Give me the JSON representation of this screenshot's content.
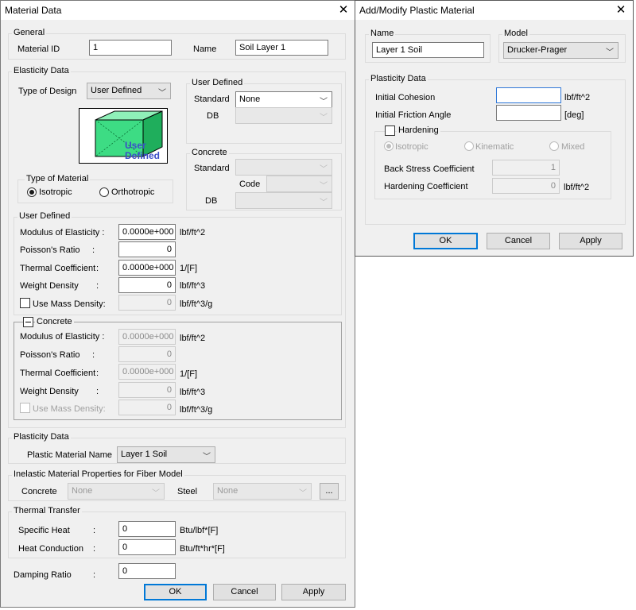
{
  "material_window": {
    "title": "Material Data",
    "general": {
      "group": "General",
      "id_label": "Material ID",
      "id_value": "1",
      "name_label": "Name",
      "name_value": "Soil Layer 1"
    },
    "elasticity": {
      "group": "Elasticity Data",
      "type_of_design_label": "Type of Design",
      "type_of_design_value": "User Defined",
      "image_text_line1": "User",
      "image_text_line2": "Defined",
      "type_of_material_group": "Type of Material",
      "isotropic": "Isotropic",
      "orthotropic": "Orthotropic",
      "user_defined_group": "User Defined",
      "standard_label": "Standard",
      "standard_value": "None",
      "db_label": "DB",
      "db_value": "",
      "concrete_group": "Concrete",
      "concrete_standard_label": "Standard",
      "concrete_standard_value": "",
      "code_label": "Code",
      "code_value": "",
      "concrete_db_label": "DB",
      "concrete_db_value": ""
    },
    "user_defined": {
      "group": "User Defined",
      "modulus_label": "Modulus of Elasticity :",
      "modulus_value": "0.0000e+000",
      "modulus_unit": "lbf/ft^2",
      "poisson_label": "Poisson's Ratio",
      "poisson_colon": ":",
      "poisson_value": "0",
      "thermal_label": "Thermal Coefficient",
      "thermal_colon": ":",
      "thermal_value": "0.0000e+000",
      "thermal_unit": "1/[F]",
      "weight_label": "Weight Density",
      "weight_colon": ":",
      "weight_value": "0",
      "weight_unit": "lbf/ft^3",
      "mass_label": "Use Mass Density:",
      "mass_value": "0",
      "mass_unit": "lbf/ft^3/g"
    },
    "concrete": {
      "group": "Concrete",
      "modulus_label": "Modulus of Elasticity :",
      "modulus_value": "0.0000e+000",
      "modulus_unit": "lbf/ft^2",
      "poisson_label": "Poisson's Ratio",
      "poisson_colon": ":",
      "poisson_value": "0",
      "thermal_label": "Thermal Coefficient",
      "thermal_colon": ":",
      "thermal_value": "0.0000e+000",
      "thermal_unit": "1/[F]",
      "weight_label": "Weight Density",
      "weight_colon": ":",
      "weight_value": "0",
      "weight_unit": "lbf/ft^3",
      "mass_label": "Use Mass Density:",
      "mass_value": "0",
      "mass_unit": "lbf/ft^3/g"
    },
    "plasticity": {
      "group": "Plasticity Data",
      "name_label": "Plastic Material Name",
      "name_value": "Layer 1 Soil"
    },
    "inelastic": {
      "group": "Inelastic Material Properties for Fiber Model",
      "concrete_label": "Concrete",
      "concrete_value": "None",
      "steel_label": "Steel",
      "steel_value": "None",
      "more_label": "..."
    },
    "thermal": {
      "group": "Thermal Transfer",
      "specific_heat_label": "Specific Heat",
      "specific_heat_colon": ":",
      "specific_heat_value": "0",
      "specific_heat_unit": "Btu/lbf*[F]",
      "heat_conduction_label": "Heat Conduction",
      "heat_conduction_colon": ":",
      "heat_conduction_value": "0",
      "heat_conduction_unit": "Btu/ft*hr*[F]"
    },
    "damping_label": "Damping Ratio",
    "damping_colon": ":",
    "damping_value": "0",
    "ok": "OK",
    "cancel": "Cancel",
    "apply": "Apply"
  },
  "plastic_window": {
    "title": "Add/Modify Plastic Material",
    "name_group": "Name",
    "name_value": "Layer 1 Soil",
    "model_group": "Model",
    "model_value": "Drucker-Prager",
    "plasticity_group": "Plasticity Data",
    "cohesion_label": "Initial Cohesion",
    "cohesion_value": "",
    "cohesion_unit": "lbf/ft^2",
    "friction_label": "Initial Friction Angle",
    "friction_value": "",
    "friction_unit": "[deg]",
    "hardening_label": "Hardening",
    "isotropic": "Isotropic",
    "kinematic": "Kinematic",
    "mixed": "Mixed",
    "back_stress_label": "Back Stress Coefficient",
    "back_stress_value": "1",
    "hardening_coef_label": "Hardening Coefficient",
    "hardening_coef_value": "0",
    "hardening_coef_unit": "lbf/ft^2",
    "ok": "OK",
    "cancel": "Cancel",
    "apply": "Apply"
  },
  "colors": {
    "dialog_bg": "#f0f0f0",
    "default_button_border": "#0078d7",
    "cube_green": "#3ddc84",
    "cube_text": "#3a4ec8"
  }
}
